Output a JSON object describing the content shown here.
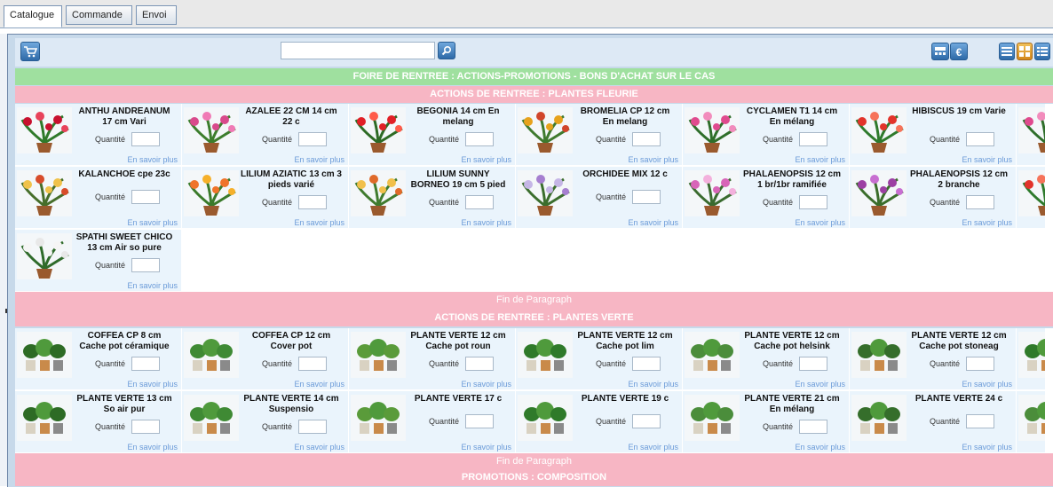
{
  "tabs": [
    {
      "label": "Catalogue",
      "active": true
    },
    {
      "label": "Commande",
      "active": false
    },
    {
      "label": "Envoi",
      "active": false
    }
  ],
  "toolbar": {
    "cart_icon": "cart-icon",
    "search": {
      "value": "",
      "placeholder": ""
    },
    "search_icon": "search-icon",
    "currency_symbol": "€",
    "view_icons": [
      "list-view-icon",
      "grid-view-icon",
      "detail-view-icon"
    ]
  },
  "banner": "FOIRE DE RENTREE : ACTIONS-PROMOTIONS - BONS D'ACHAT SUR LE CAS",
  "sections": [
    {
      "title": "ACTIONS DE RENTREE : PLANTES FLEURIE",
      "products": [
        {
          "name": "ANTHU ANDREANUM 17 cm Vari"
        },
        {
          "name": "AZALEE 22 CM 14 cm 22 c"
        },
        {
          "name": "BEGONIA 14 cm En melang"
        },
        {
          "name": "BROMELIA CP 12 cm En melang"
        },
        {
          "name": "CYCLAMEN T1 14 cm En mélang"
        },
        {
          "name": "HIBISCUS 19 cm Varie"
        },
        {
          "name": "KALANCHOE cpe 23c"
        },
        {
          "name": "LILIUM AZIATIC 13 cm 3 pieds varié"
        },
        {
          "name": "LILIUM SUNNY BORNEO 19 cm 5 pied"
        },
        {
          "name": "ORCHIDEE MIX 12 c"
        },
        {
          "name": "PHALAENOPSIS 12 cm 1 br/1br ramifiée"
        },
        {
          "name": "PHALAENOPSIS 12 cm 2 branche"
        },
        {
          "name": "SPATHI SWEET CHICO 13 cm Air so pure"
        }
      ]
    },
    {
      "title": "ACTIONS DE RENTREE : PLANTES VERTE",
      "products": [
        {
          "name": "COFFEA CP 8 cm Cache pot céramique"
        },
        {
          "name": "COFFEA CP 12 cm Cover pot"
        },
        {
          "name": "PLANTE VERTE 12 cm Cache pot roun"
        },
        {
          "name": "PLANTE VERTE 12 cm Cache pot lim"
        },
        {
          "name": "PLANTE VERTE 12 cm Cache pot helsink"
        },
        {
          "name": "PLANTE VERTE 12 cm Cache pot stoneag"
        },
        {
          "name": "PLANTE VERTE 13 cm So air pur"
        },
        {
          "name": "PLANTE VERTE 14 cm Suspensio"
        },
        {
          "name": "PLANTE VERTE 17 c"
        },
        {
          "name": "PLANTE VERTE 19 c"
        },
        {
          "name": "PLANTE VERTE 21 cm En mélang"
        },
        {
          "name": "PLANTE VERTE 24 c"
        }
      ]
    },
    {
      "title": "PROMOTIONS : COMPOSITION",
      "products": []
    }
  ],
  "labels": {
    "quantity": "Quantité",
    "more": "En savoir plus",
    "end_paragraph": "Fin de Paragraph"
  },
  "colors": {
    "banner_green": "#9fe09f",
    "section_pink": "#f7b6c4",
    "cell_bg": "#eaf4fc",
    "link_blue": "#6a9ad8"
  }
}
